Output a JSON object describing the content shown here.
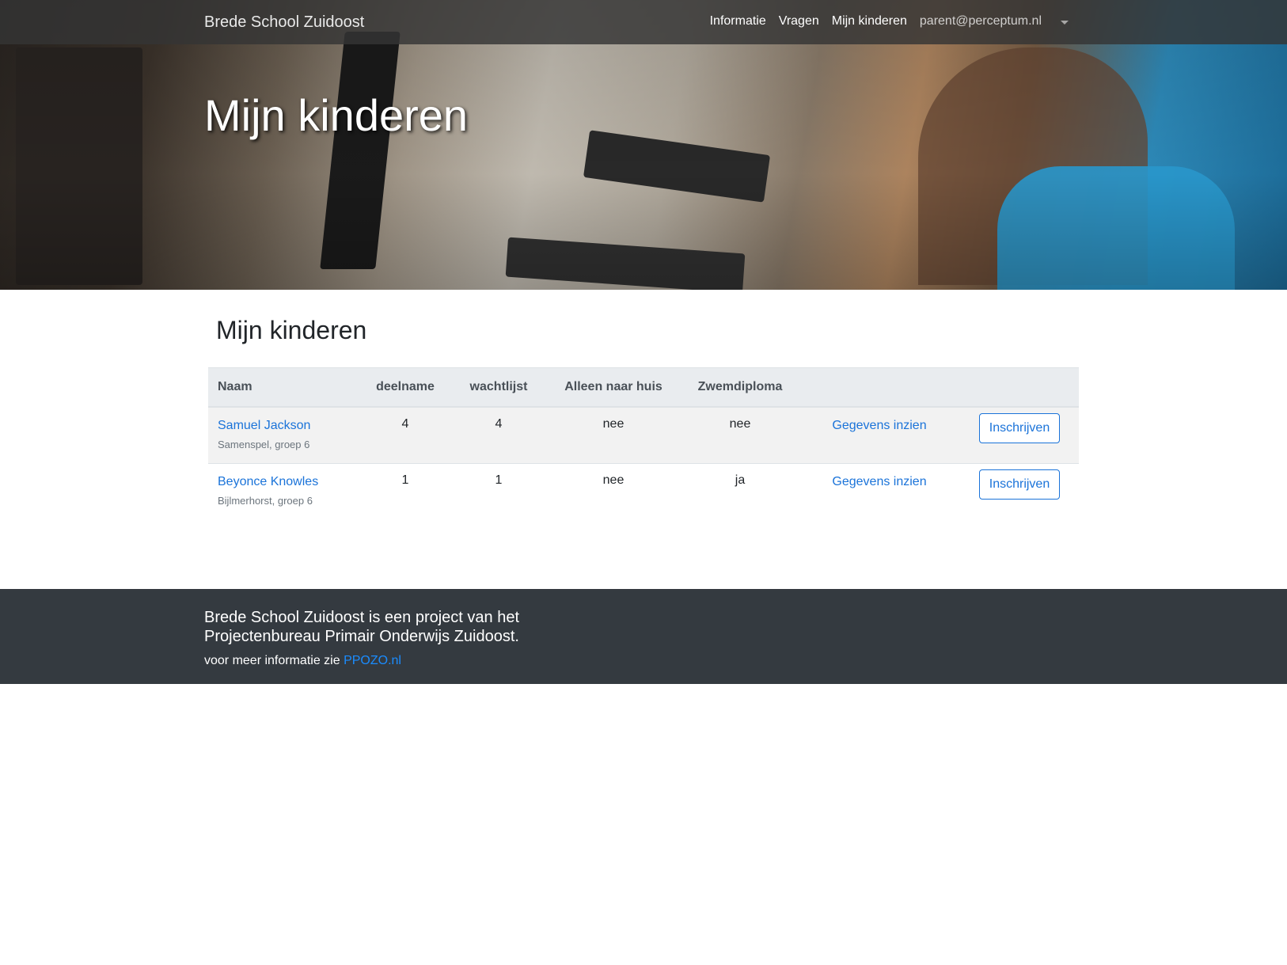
{
  "navbar": {
    "brand": "Brede School Zuidoost",
    "items": [
      {
        "label": "Informatie"
      },
      {
        "label": "Vragen"
      },
      {
        "label": "Mijn kinderen"
      },
      {
        "label": "parent@perceptum.nl"
      }
    ]
  },
  "hero": {
    "title": "Mijn kinderen"
  },
  "main": {
    "title": "Mijn kinderen",
    "table": {
      "headers": [
        "Naam",
        "deelname",
        "wachtlijst",
        "Alleen naar huis",
        "Zwemdiploma",
        "",
        ""
      ],
      "rows": [
        {
          "name": "Samuel Jackson",
          "school": "Samenspel, groep 6",
          "deelname": "4",
          "wachtlijst": "4",
          "alleen_naar_huis": "nee",
          "zwemdiploma": "nee",
          "view_label": "Gegevens inzien",
          "enroll_label": "Inschrijven"
        },
        {
          "name": "Beyonce Knowles",
          "school": "Bijlmerhorst, groep 6",
          "deelname": "1",
          "wachtlijst": "1",
          "alleen_naar_huis": "nee",
          "zwemdiploma": "ja",
          "view_label": "Gegevens inzien",
          "enroll_label": "Inschrijven"
        }
      ]
    }
  },
  "footer": {
    "text": "Brede School Zuidoost is een project van het Projectenbureau Primair Onderwijs Zuidoost.",
    "info_prefix": "voor meer informatie zie",
    "info_link": "PPOZO.nl"
  },
  "colors": {
    "link": "#1a73d9",
    "footer_bg": "#343a40",
    "header_bg": "#e9ecef"
  }
}
